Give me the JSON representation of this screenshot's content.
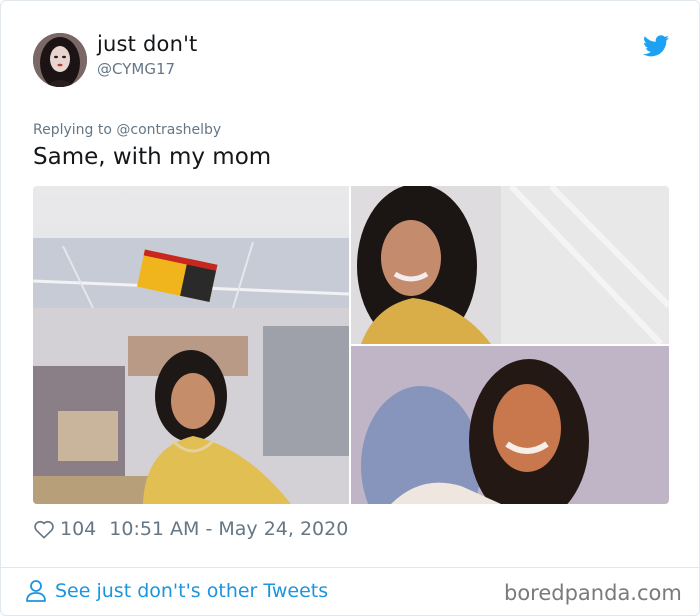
{
  "tweet": {
    "display_name": "just don't",
    "handle": "@CYMG17",
    "replying_to": "Replying to @contrashelby",
    "text": "Same, with my mom",
    "likes": "104",
    "timestamp": "10:51 AM - May 24, 2020"
  },
  "footer": {
    "more_tweets_label": "See just don't's other Tweets",
    "watermark": "boredpanda.com"
  },
  "icons": {
    "brand": "twitter-bird-icon",
    "like": "heart-icon",
    "profile": "person-icon"
  },
  "colors": {
    "accent": "#1da1f2",
    "link": "#1b95e0",
    "muted": "#657786",
    "text": "#14171a",
    "border": "#e1e8ed"
  }
}
